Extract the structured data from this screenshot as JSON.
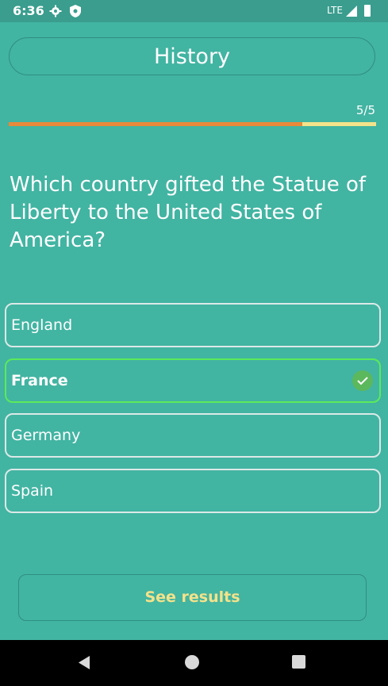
{
  "status_bar": {
    "time": "6:36",
    "network": "LTE",
    "icons": [
      "gear-icon",
      "shield-icon",
      "signal-icon",
      "battery-icon"
    ]
  },
  "header": {
    "title": "History"
  },
  "progress": {
    "label": "5/5",
    "fraction": 0.8
  },
  "question": {
    "text": "Which country gifted the Statue of Liberty to the United States of America?"
  },
  "options": [
    {
      "label": "England",
      "selected": false
    },
    {
      "label": "France",
      "selected": true,
      "indicator_icon": "check-circle-icon"
    },
    {
      "label": "Germany",
      "selected": false
    },
    {
      "label": "Spain",
      "selected": false
    }
  ],
  "actions": {
    "see_results_label": "See results"
  },
  "nav": {
    "icons": [
      "back-icon",
      "home-icon",
      "recents-icon"
    ]
  },
  "colors": {
    "background": "#42b4a2",
    "progress_fill": "#e9893a",
    "progress_track": "#f4e28a",
    "selected_border": "#5bea5a",
    "check": "#5cb85c",
    "results_text": "#f4e28a"
  }
}
